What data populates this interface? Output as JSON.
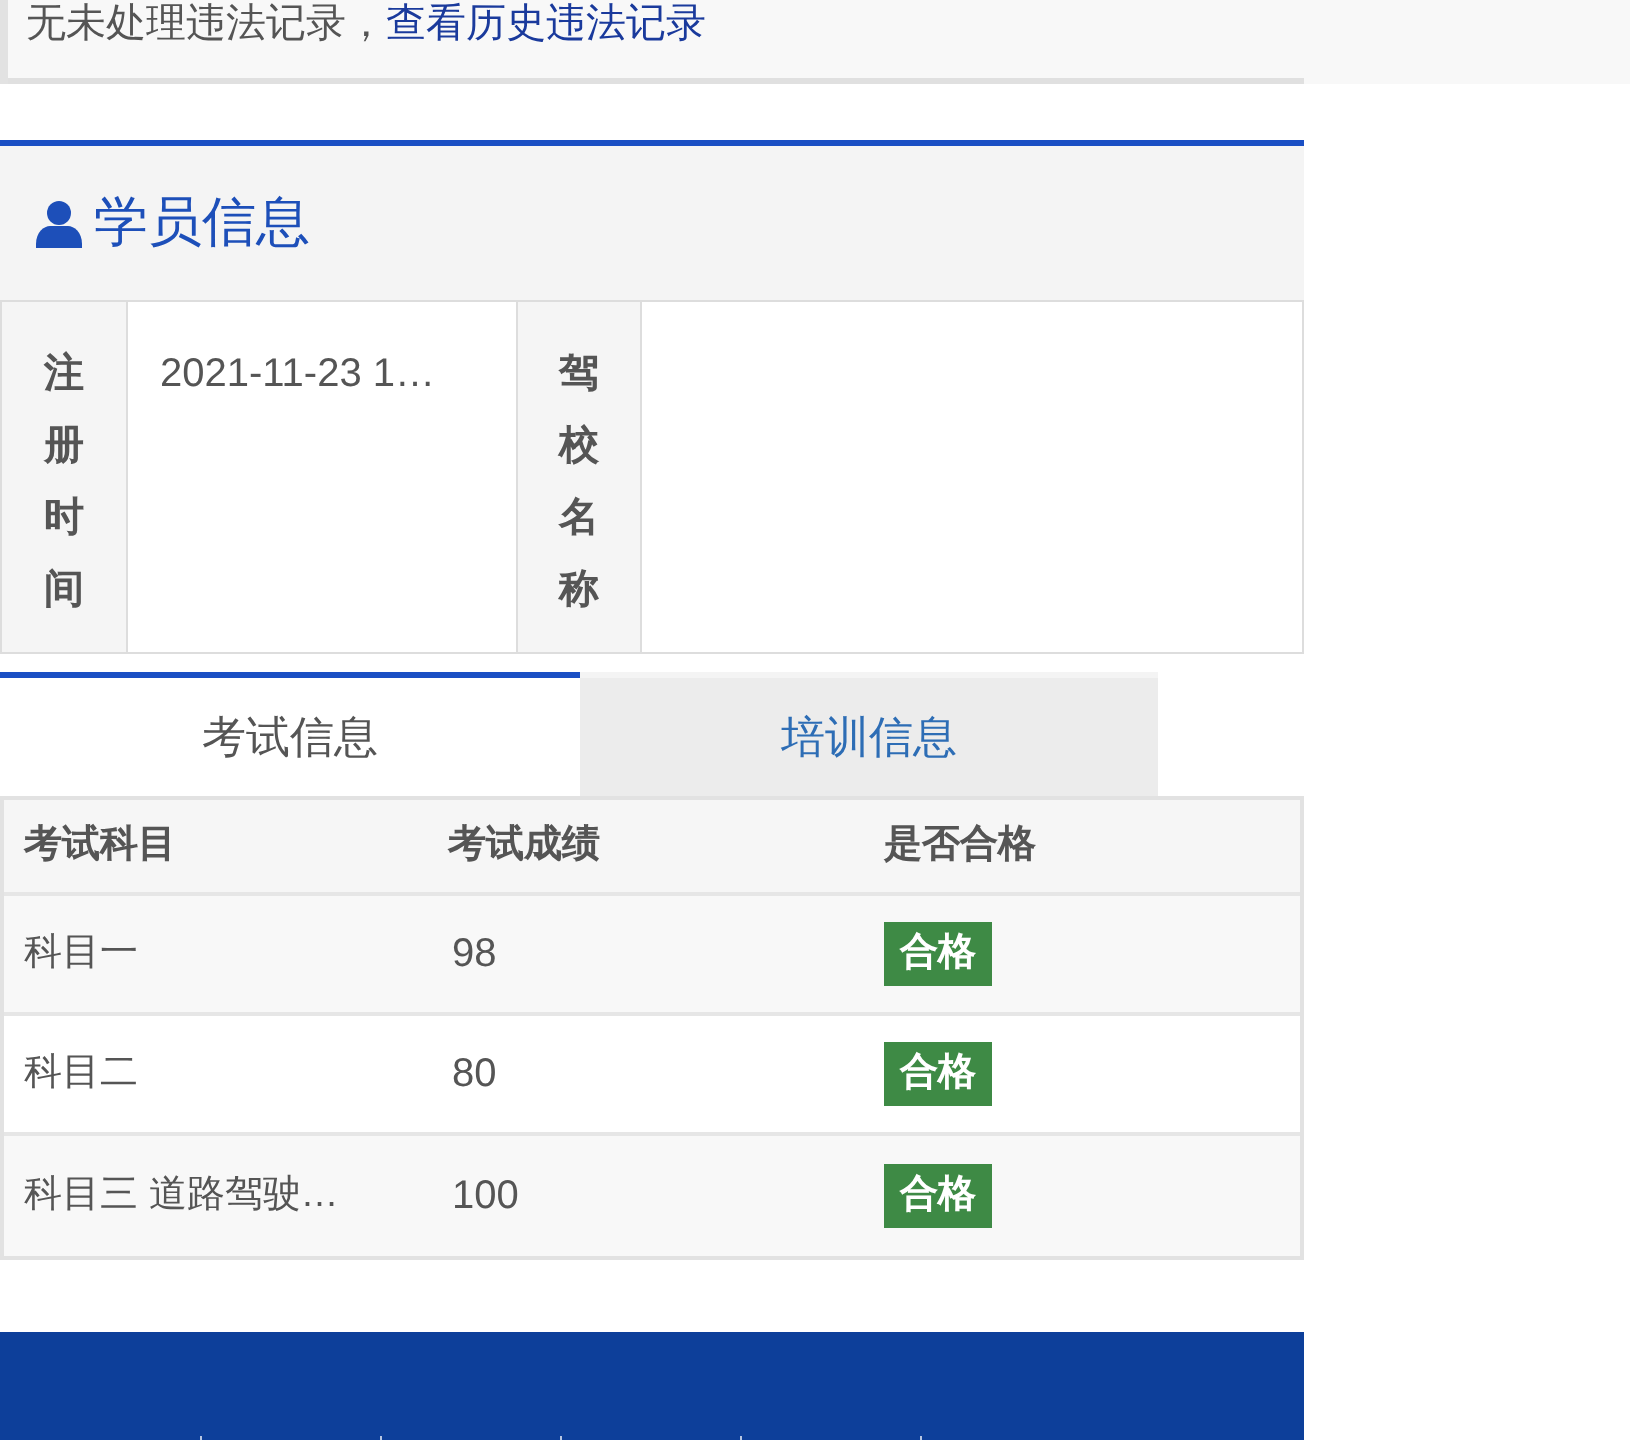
{
  "notice": {
    "text": "无未处理违法记录，",
    "link": "查看历史违法记录"
  },
  "section": {
    "title": "学员信息"
  },
  "info": [
    {
      "label": "注册时间",
      "value": "2021-11-23 1…"
    },
    {
      "label": "驾校名称"
    }
  ],
  "tabs": [
    {
      "label": "考试信息",
      "selected": true
    },
    {
      "label": "培训信息",
      "selected": false
    }
  ],
  "table": {
    "columns": [
      "考试科目",
      "考试成绩",
      "是否合格"
    ],
    "rows": [
      {
        "subject": "科目一",
        "score": "98",
        "result": "合格"
      },
      {
        "subject": "科目二",
        "score": "80",
        "result": "合格"
      },
      {
        "subject": "科目三 道路驾驶…",
        "score": "100",
        "result": "合格"
      }
    ]
  }
}
